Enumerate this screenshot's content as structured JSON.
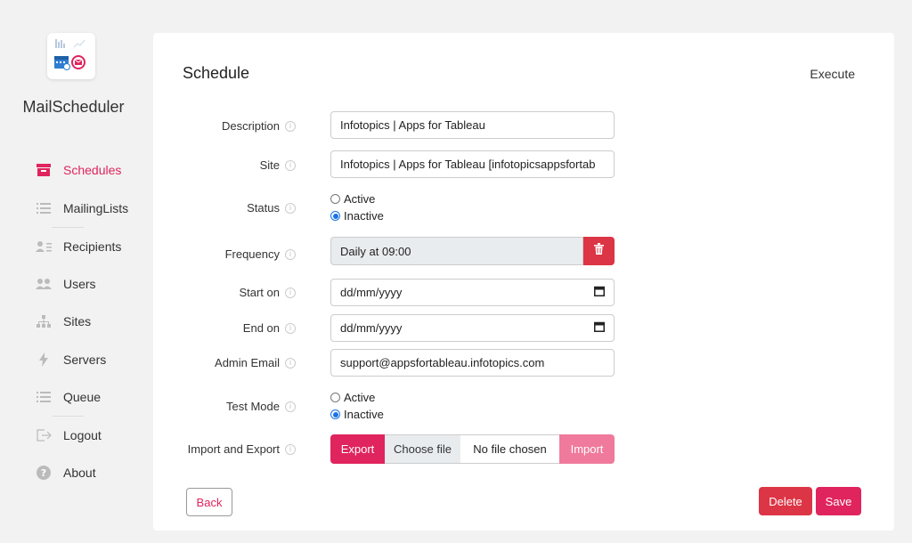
{
  "app": {
    "name": "MailScheduler",
    "accent": "#e0245e",
    "danger": "#dc3545"
  },
  "sidebar": {
    "items": [
      {
        "label": "Schedules",
        "icon": "archive-icon",
        "active": true
      },
      {
        "label": "MailingLists",
        "icon": "list-icon",
        "active": false
      },
      {
        "label": "Recipients",
        "icon": "user-list-icon",
        "active": false
      },
      {
        "label": "Users",
        "icon": "users-icon",
        "active": false
      },
      {
        "label": "Sites",
        "icon": "sitemap-icon",
        "active": false
      },
      {
        "label": "Servers",
        "icon": "bolt-icon",
        "active": false
      },
      {
        "label": "Queue",
        "icon": "list-icon",
        "active": false
      },
      {
        "label": "Logout",
        "icon": "logout-icon",
        "active": false
      },
      {
        "label": "About",
        "icon": "help-icon",
        "active": false
      }
    ]
  },
  "page": {
    "title": "Schedule",
    "execute_label": "Execute"
  },
  "form": {
    "description": {
      "label": "Description",
      "value": "Infotopics | Apps for Tableau"
    },
    "site": {
      "label": "Site",
      "value": "Infotopics | Apps for Tableau [infotopicsappsfortab"
    },
    "status": {
      "label": "Status",
      "options": [
        "Active",
        "Inactive"
      ],
      "selected": "Inactive"
    },
    "frequency": {
      "label": "Frequency",
      "value": "Daily at 09:00"
    },
    "start_on": {
      "label": "Start on",
      "placeholder": "dd/mm/yyyy"
    },
    "end_on": {
      "label": "End on",
      "placeholder": "dd/mm/yyyy"
    },
    "admin_email": {
      "label": "Admin Email",
      "value": "support@appsfortableau.infotopics.com"
    },
    "test_mode": {
      "label": "Test Mode",
      "options": [
        "Active",
        "Inactive"
      ],
      "selected": "Inactive"
    },
    "import_export": {
      "label": "Import and Export",
      "export_label": "Export",
      "choose_label": "Choose file",
      "no_file_label": "No file chosen",
      "import_label": "Import"
    }
  },
  "actions": {
    "back_label": "Back",
    "delete_label": "Delete",
    "save_label": "Save"
  }
}
